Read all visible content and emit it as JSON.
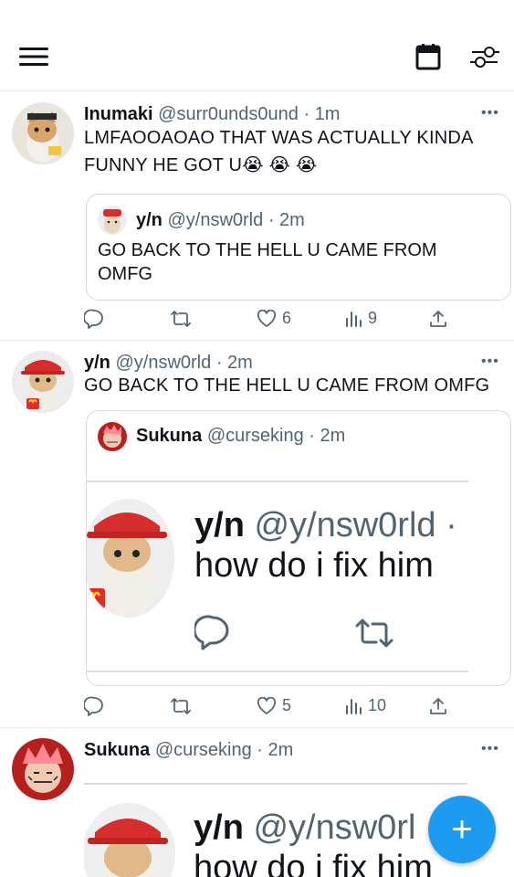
{
  "nav": {
    "menu_icon": "hamburger-icon",
    "calendar_icon": "calendar-icon",
    "filter_icon": "sliders-icon"
  },
  "tweets": [
    {
      "name": "Inumaki",
      "handle": "@surr0unds0und",
      "time": "· 1m",
      "more": "•••",
      "text_line1": "LMFAOOAOAO THAT WAS ACTUALLY KINDA",
      "text_line2": "FUNNY HE GOT U😭 😭 😭",
      "quote": {
        "name": "y/n",
        "handle": "@y/nsw0rld",
        "time": "· 2m",
        "text_line1": "GO BACK TO THE HELL U CAME FROM",
        "text_line2": "OMFG"
      },
      "likes": "6",
      "views": "9"
    },
    {
      "name": "y/n",
      "handle": "@y/nsw0rld",
      "time": "· 2m",
      "more": "•••",
      "text_line1": "GO BACK TO THE HELL U CAME FROM OMFG",
      "quote": {
        "name": "Sukuna",
        "handle": "@curseking",
        "time": "· 2m",
        "shot_name": "y/n",
        "shot_handle": "@y/nsw0rld ·",
        "shot_text": "how do i fix him"
      },
      "likes": "5",
      "views": "10"
    },
    {
      "name": "Sukuna",
      "handle": "@curseking",
      "time": "· 2m",
      "more": "•••",
      "shot_name": "y/n",
      "shot_handle": "@y/nsw0rl",
      "shot_text": "how do i fix him"
    }
  ],
  "fab": {
    "label": "+"
  },
  "colors": {
    "accent": "#1d9bf0",
    "muted": "#536471",
    "border": "#e6e9ec"
  }
}
